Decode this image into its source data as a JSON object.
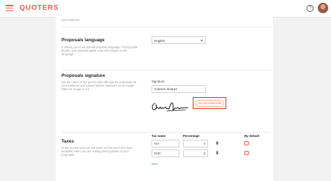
{
  "header": {
    "logo": "QUOTERS",
    "menu_icon": "menu-icon",
    "help_icon": "help-icon",
    "avatar": "user-avatar"
  },
  "business": {
    "desc_tail": "your business."
  },
  "language": {
    "title": "Proposals language",
    "description": "It allows you to set default proposal language. Pricing table header and proposal public view will change in this language.",
    "selected": "English"
  },
  "signature": {
    "title": "Proposals signature",
    "description": "Set the name of the person who will sign the proposals for your business and upload his/her signature as an image. Ratio for image is 4:3.",
    "field_label": "Signature",
    "name_value": "Carmen Alvarez",
    "signature_text": "Carmen Alvarez",
    "upload_label": "UPLOAD SIGNATURE"
  },
  "taxes": {
    "title": "Taxes",
    "description": "In this section you can set taxes so that you have them available when you are editing pricing tables of your proposals.",
    "columns": {
      "name": "Tax name",
      "percentage": "Percentage",
      "default": "By default"
    },
    "rows": [
      {
        "name": "IVA",
        "percentage": "4"
      },
      {
        "name": "IGIC",
        "percentage": "3"
      }
    ],
    "new_label": "New"
  },
  "colors": {
    "accent": "#e8584a",
    "highlight": "#e3262b",
    "link": "#4a90d9"
  }
}
